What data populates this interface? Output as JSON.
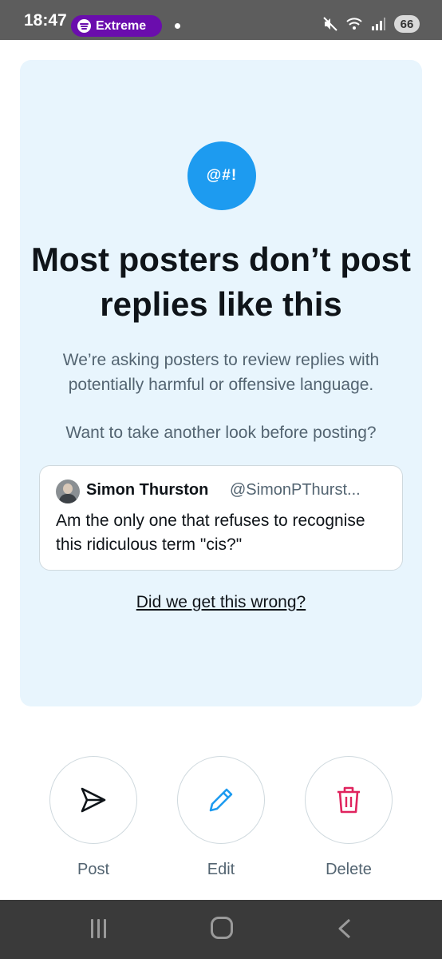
{
  "status_bar": {
    "time": "18:47",
    "spotify_label": "Extreme",
    "battery": "66",
    "icons": [
      "spotify-icon",
      "mute-icon",
      "wifi-icon",
      "signal-icon",
      "battery-icon"
    ]
  },
  "card": {
    "badge": "@#!",
    "headline": "Most posters don’t post replies like this",
    "subtext": "We’re asking posters to review replies with potentially harmful or offensive language.",
    "question": "Want to take another look before posting?",
    "tweet": {
      "name": "Simon Thurston",
      "handle": "@SimonPThurst...",
      "text": "Am the only one that refuses to recognise this ridiculous term \"cis?\""
    },
    "link": "Did we get this wrong?"
  },
  "actions": [
    {
      "label": "Post",
      "icon": "send-icon",
      "color": "#0f1419"
    },
    {
      "label": "Edit",
      "icon": "pencil-icon",
      "color": "#1d9bf0"
    },
    {
      "label": "Delete",
      "icon": "trash-icon",
      "color": "#e0245e"
    }
  ],
  "colors": {
    "accent": "#1d9bf0",
    "card_bg": "#e8f5fd",
    "delete": "#e0245e",
    "spotify_pill": "#6a0dad"
  }
}
